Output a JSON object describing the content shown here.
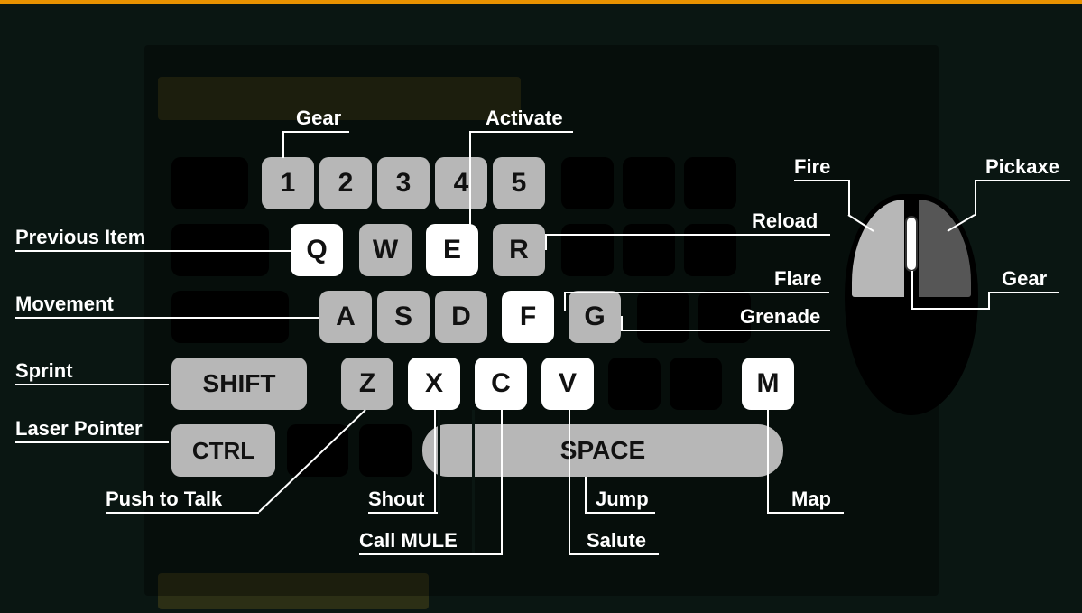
{
  "keys": {
    "n1": "1",
    "n2": "2",
    "n3": "3",
    "n4": "4",
    "n5": "5",
    "q": "Q",
    "w": "W",
    "e": "E",
    "r": "R",
    "a": "A",
    "s": "S",
    "d": "D",
    "f": "F",
    "g": "G",
    "shift": "SHIFT",
    "z": "Z",
    "x": "X",
    "c": "C",
    "v": "V",
    "m": "M",
    "ctrl": "CTRL",
    "space": "SPACE"
  },
  "labels": {
    "gear": "Gear",
    "activate": "Activate",
    "previous_item": "Previous Item",
    "movement": "Movement",
    "sprint": "Sprint",
    "laser_pointer": "Laser Pointer",
    "push_to_talk": "Push to Talk",
    "shout": "Shout",
    "call_mule": "Call MULE",
    "salute": "Salute",
    "jump": "Jump",
    "map": "Map",
    "reload": "Reload",
    "flare": "Flare",
    "grenade": "Grenade",
    "fire": "Fire",
    "pickaxe": "Pickaxe",
    "mouse_gear": "Gear"
  }
}
